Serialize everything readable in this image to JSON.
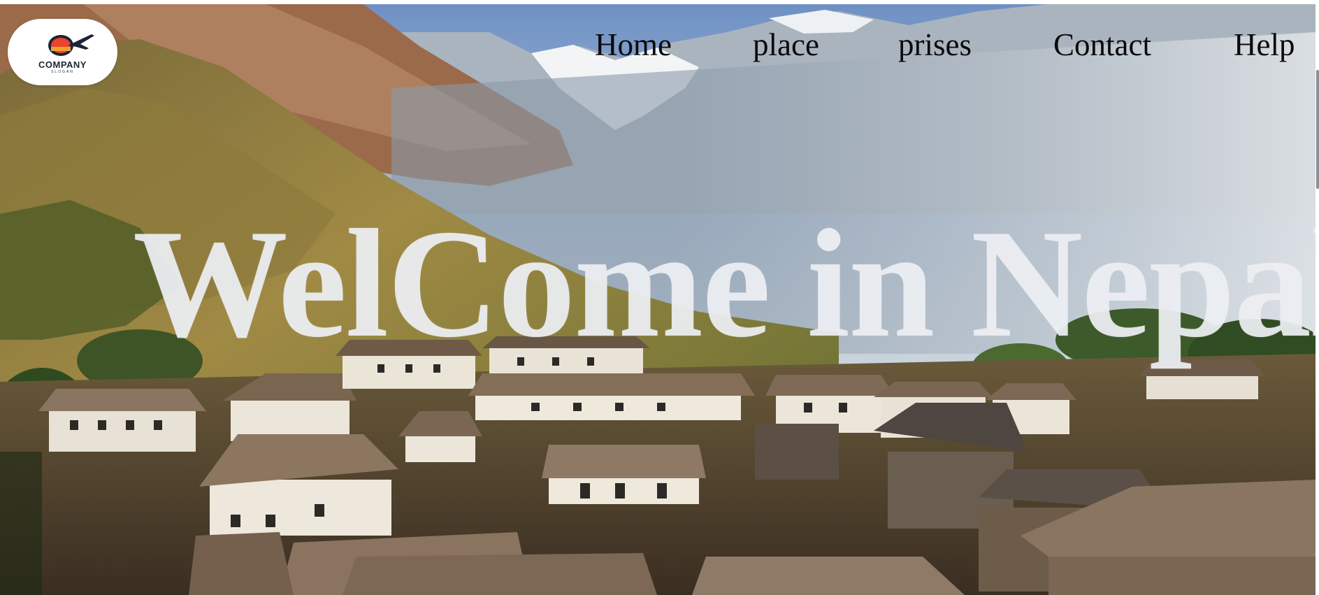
{
  "logo": {
    "name": "COMPANY",
    "slogan": "SLOGAN",
    "icon": "globe-plane-icon"
  },
  "nav": {
    "items": [
      {
        "label": "Home"
      },
      {
        "label": "place"
      },
      {
        "label": "prises"
      },
      {
        "label": "Contact"
      },
      {
        "label": "Help"
      }
    ]
  },
  "hero": {
    "headline": "WelCome in Nepal",
    "background": "mountain-village-photo"
  },
  "colors": {
    "headline": "#eceef2",
    "nav_text": "#0a0a0a",
    "logo_bg": "#ffffff"
  }
}
